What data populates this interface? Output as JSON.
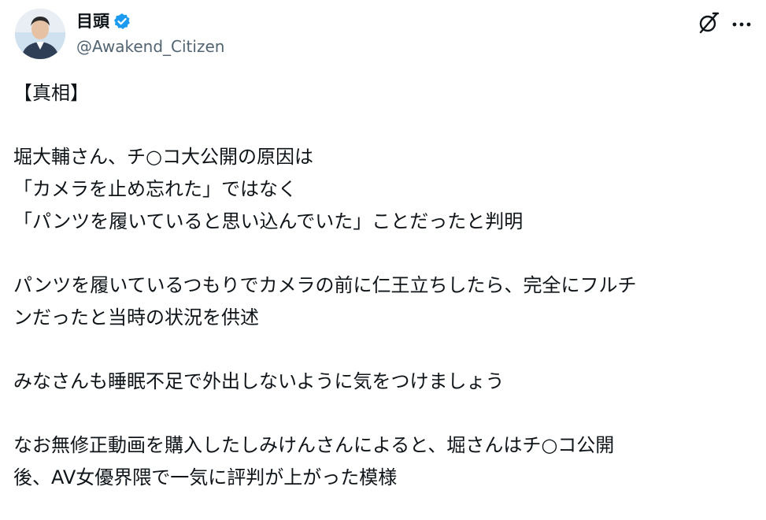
{
  "author": {
    "display_name": "目頭",
    "handle": "@Awakend_Citizen",
    "verified": true
  },
  "icons": {
    "verified": "verified-badge-icon",
    "grok": "grok-icon",
    "more": "more-options-icon"
  },
  "colors": {
    "text": "#0f1419",
    "secondary": "#536471",
    "verified_blue": "#1d9bf0"
  },
  "tweet": {
    "paragraphs": [
      [
        "【真相】"
      ],
      [
        "堀大輔さん、チ○コ大公開の原因は",
        "「カメラを止め忘れた」ではなく",
        "「パンツを履いていると思い込んでいた」ことだったと判明"
      ],
      [
        "パンツを履いているつもりでカメラの前に仁王立ちしたら、完全にフルチ",
        "ンだったと当時の状況を供述"
      ],
      [
        "みなさんも睡眠不足で外出しないように気をつけましょう"
      ],
      [
        "なお無修正動画を購入したしみけんさんによると、堀さんはチ○コ公開",
        "後、AV女優界隈で一気に評判が上がった模様"
      ]
    ]
  }
}
